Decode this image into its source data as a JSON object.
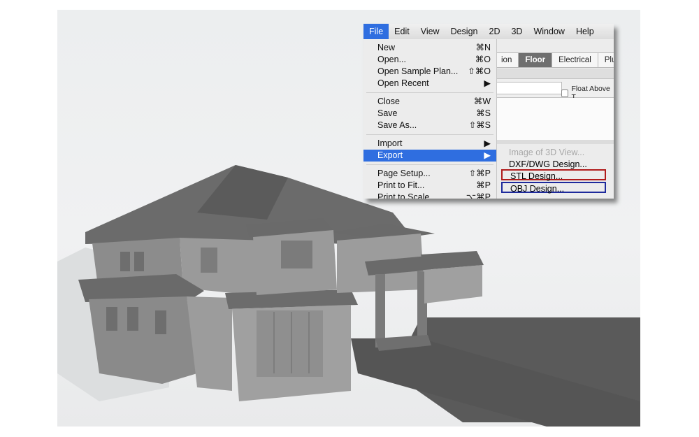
{
  "menubar": {
    "items": [
      "File",
      "Edit",
      "View",
      "Design",
      "2D",
      "3D",
      "Window",
      "Help"
    ]
  },
  "tabs": {
    "items": [
      "ion",
      "Floor",
      "Electrical",
      "Plun"
    ],
    "selected": "Floor"
  },
  "toolbar": {
    "float_above": "Float Above T"
  },
  "file_menu": {
    "items": [
      {
        "label": "New",
        "shortcut": "⌘N"
      },
      {
        "label": "Open...",
        "shortcut": "⌘O"
      },
      {
        "label": "Open Sample Plan...",
        "shortcut": "⇧⌘O"
      },
      {
        "label": "Open Recent",
        "shortcut": "▶"
      },
      {
        "label": "Close",
        "shortcut": "⌘W"
      },
      {
        "label": "Save",
        "shortcut": "⌘S"
      },
      {
        "label": "Save As...",
        "shortcut": "⇧⌘S"
      },
      {
        "label": "Import",
        "shortcut": "▶"
      },
      {
        "label": "Export",
        "shortcut": "▶"
      },
      {
        "label": "Page Setup...",
        "shortcut": "⇧⌘P"
      },
      {
        "label": "Print to Fit...",
        "shortcut": "⌘P"
      },
      {
        "label": "Print to Scale...",
        "shortcut": "⌥⌘P"
      }
    ]
  },
  "export_submenu": {
    "items": [
      "Image of 3D View...",
      "DXF/DWG Design...",
      "STL Design...",
      "OBJ Design..."
    ]
  },
  "colors": {
    "accent": "#2f6ee0",
    "highlight_red": "#b01c1c",
    "highlight_blue": "#1e2a9c",
    "house": "#8a8a8a"
  }
}
